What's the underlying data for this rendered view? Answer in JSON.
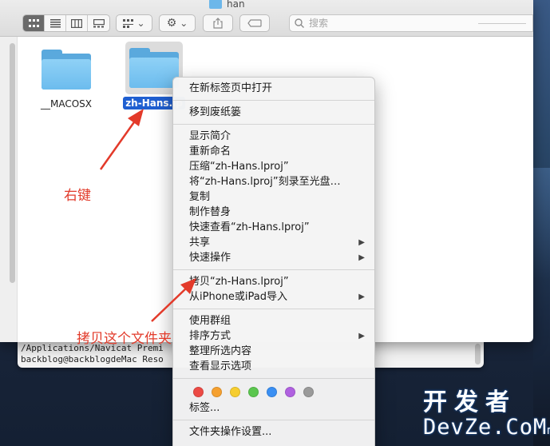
{
  "window": {
    "title": "han"
  },
  "toolbar": {
    "view_buttons": [
      "icon-view",
      "list-view",
      "column-view",
      "gallery-view"
    ],
    "group_label": "group-by",
    "action_label": "action",
    "share_label": "share",
    "tag_label": "tag",
    "search_placeholder": "搜索"
  },
  "files": [
    {
      "name": "__MACOSX",
      "selected": false
    },
    {
      "name": "zh-Hans.lp",
      "selected": true
    }
  ],
  "context_menu": {
    "group1": [
      "在新标签页中打开"
    ],
    "group2": [
      "移到废纸篓"
    ],
    "group3": [
      {
        "label": "显示简介",
        "submenu": false
      },
      {
        "label": "重新命名",
        "submenu": false
      },
      {
        "label": "压缩“zh-Hans.lproj”",
        "submenu": false
      },
      {
        "label": "将“zh-Hans.lproj”刻录至光盘…",
        "submenu": false
      },
      {
        "label": "复制",
        "submenu": false
      },
      {
        "label": "制作替身",
        "submenu": false
      },
      {
        "label": "快速查看“zh-Hans.lproj”",
        "submenu": false
      },
      {
        "label": "共享",
        "submenu": true
      },
      {
        "label": "快速操作",
        "submenu": true
      }
    ],
    "group4": [
      {
        "label": "拷贝“zh-Hans.lproj”",
        "submenu": false
      },
      {
        "label": "从iPhone或iPad导入",
        "submenu": true
      }
    ],
    "group5": [
      {
        "label": "使用群组",
        "submenu": false
      },
      {
        "label": "排序方式",
        "submenu": true
      },
      {
        "label": "整理所选内容",
        "submenu": false
      },
      {
        "label": "查看显示选项",
        "submenu": false
      }
    ],
    "tag_colors": [
      "#ec4a45",
      "#f5a030",
      "#f6cd2f",
      "#5bc64f",
      "#3a8ff3",
      "#b061e0",
      "#9a9a9a"
    ],
    "tags_label": "标签...",
    "settings_label": "文件夹操作设置..."
  },
  "terminal": {
    "line1": "/Applications/Navicat Premi",
    "line2": "backblog@backblogdeMac Reso"
  },
  "annotations": {
    "right_click": "右键",
    "copy_folder": "拷贝这个文件夹"
  },
  "watermark": {
    "cn": "开发者",
    "en_main": "DevZe.CoM",
    "en_suffix": "m"
  }
}
